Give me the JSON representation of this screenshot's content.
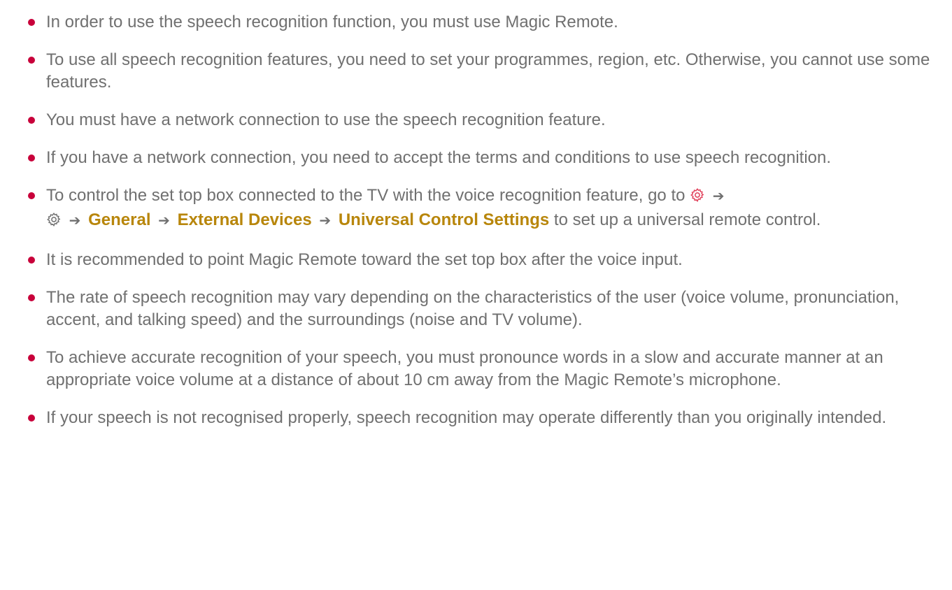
{
  "notes": [
    "In order to use the speech recognition function, you must use Magic Remote.",
    "To use all speech recognition features, you need to set your programmes, region, etc. Otherwise, you cannot use some features.",
    "You must have a network connection to use the speech recognition feature.",
    "If you have a network connection, you need to accept the terms and conditions to use speech recognition.",
    {
      "intro": "To control the set top box connected to the TV with the voice recognition feature, go to",
      "path": [
        "General",
        "External Devices",
        "Universal Control Settings"
      ],
      "outro": "to set up a universal remote control.",
      "icons": [
        "settings-gear-icon-red",
        "settings-gear-icon-grey"
      ]
    },
    "It is recommended to point Magic Remote toward the set top box after the voice input.",
    "The rate of speech recognition may vary depending on the characteristics of the user (voice volume, pronunciation, accent, and talking speed) and the surroundings (noise and TV volume).",
    "To achieve accurate recognition of your speech, you must pronounce words in a slow and accurate manner at an appropriate voice volume at a distance of about 10 cm away from the Magic Remote’s microphone.",
    "If your speech is not recognised properly, speech recognition may operate differently than you originally intended."
  ],
  "colors": {
    "bullet": "#c8003a",
    "highlight": "#b8860b",
    "text": "#707070",
    "gear_red": "#e0405a",
    "gear_grey": "#707070"
  }
}
